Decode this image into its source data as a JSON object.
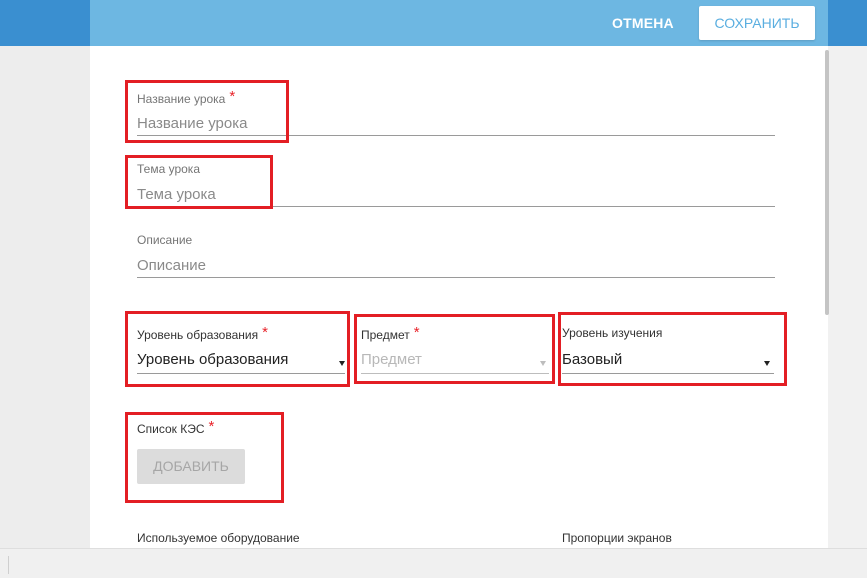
{
  "header": {
    "cancel_label": "ОТМЕНА",
    "save_label": "СОХРАНИТЬ"
  },
  "form": {
    "lesson_name": {
      "label": "Название урока",
      "required": "*",
      "placeholder": "Название урока"
    },
    "lesson_topic": {
      "label": "Тема урока",
      "placeholder": "Тема урока"
    },
    "description": {
      "label": "Описание",
      "placeholder": "Описание"
    },
    "education_level": {
      "label": "Уровень образования",
      "required": "*",
      "value": "Уровень образования"
    },
    "subject": {
      "label": "Предмет",
      "required": "*",
      "value": "Предмет"
    },
    "study_level": {
      "label": "Уровень изучения",
      "value": "Базовый"
    },
    "kes_list": {
      "label": "Список КЭС",
      "required": "*",
      "add_label": "ДОБАВИТЬ"
    },
    "equipment": {
      "label": "Используемое оборудование"
    },
    "screen_proportions": {
      "label": "Пропорции экранов"
    }
  },
  "colors": {
    "header_bg": "#6db7e2",
    "accent": "#3a8fd0",
    "required": "#e8232a",
    "highlight": "#e31e24"
  }
}
